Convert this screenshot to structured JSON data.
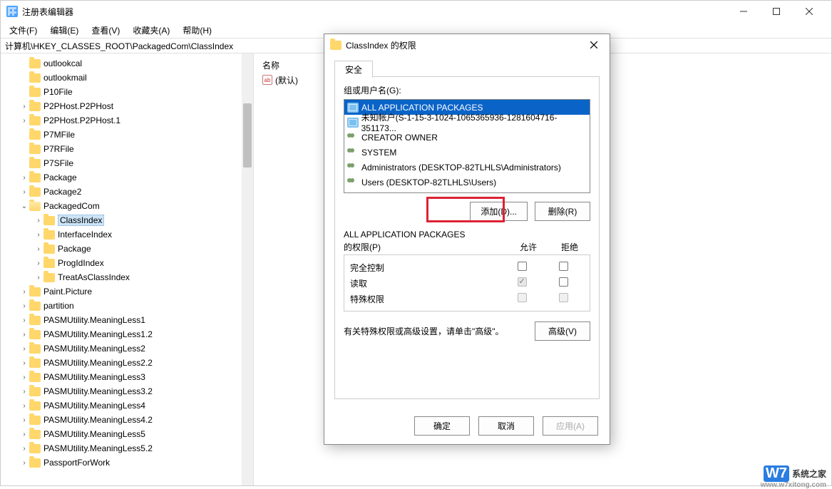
{
  "window": {
    "title": "注册表编辑器",
    "controls": {
      "min": "minimize",
      "max": "maximize",
      "close": "close"
    }
  },
  "menu": {
    "file": "文件(F)",
    "edit": "编辑(E)",
    "view": "查看(V)",
    "fav": "收藏夹(A)",
    "help": "帮助(H)"
  },
  "address": "计算机\\HKEY_CLASSES_ROOT\\PackagedCom\\ClassIndex",
  "list": {
    "header_name": "名称",
    "default_item": "(默认)"
  },
  "tree": [
    {
      "indent": 26,
      "chev": "",
      "label": "outlookcal"
    },
    {
      "indent": 26,
      "chev": "",
      "label": "outlookmail"
    },
    {
      "indent": 26,
      "chev": "",
      "label": "P10File"
    },
    {
      "indent": 26,
      "chev": ">",
      "label": "P2PHost.P2PHost"
    },
    {
      "indent": 26,
      "chev": ">",
      "label": "P2PHost.P2PHost.1"
    },
    {
      "indent": 26,
      "chev": "",
      "label": "P7MFile"
    },
    {
      "indent": 26,
      "chev": "",
      "label": "P7RFile"
    },
    {
      "indent": 26,
      "chev": "",
      "label": "P7SFile"
    },
    {
      "indent": 26,
      "chev": ">",
      "label": "Package"
    },
    {
      "indent": 26,
      "chev": ">",
      "label": "Package2"
    },
    {
      "indent": 26,
      "chev": "v",
      "label": "PackagedCom",
      "open": true
    },
    {
      "indent": 46,
      "chev": ">",
      "label": "ClassIndex",
      "selected": true
    },
    {
      "indent": 46,
      "chev": ">",
      "label": "InterfaceIndex"
    },
    {
      "indent": 46,
      "chev": ">",
      "label": "Package"
    },
    {
      "indent": 46,
      "chev": ">",
      "label": "ProgIdIndex"
    },
    {
      "indent": 46,
      "chev": ">",
      "label": "TreatAsClassIndex"
    },
    {
      "indent": 26,
      "chev": ">",
      "label": "Paint.Picture"
    },
    {
      "indent": 26,
      "chev": ">",
      "label": "partition"
    },
    {
      "indent": 26,
      "chev": ">",
      "label": "PASMUtility.MeaningLess1"
    },
    {
      "indent": 26,
      "chev": ">",
      "label": "PASMUtility.MeaningLess1.2"
    },
    {
      "indent": 26,
      "chev": ">",
      "label": "PASMUtility.MeaningLess2"
    },
    {
      "indent": 26,
      "chev": ">",
      "label": "PASMUtility.MeaningLess2.2"
    },
    {
      "indent": 26,
      "chev": ">",
      "label": "PASMUtility.MeaningLess3"
    },
    {
      "indent": 26,
      "chev": ">",
      "label": "PASMUtility.MeaningLess3.2"
    },
    {
      "indent": 26,
      "chev": ">",
      "label": "PASMUtility.MeaningLess4"
    },
    {
      "indent": 26,
      "chev": ">",
      "label": "PASMUtility.MeaningLess4.2"
    },
    {
      "indent": 26,
      "chev": ">",
      "label": "PASMUtility.MeaningLess5"
    },
    {
      "indent": 26,
      "chev": ">",
      "label": "PASMUtility.MeaningLess5.2"
    },
    {
      "indent": 26,
      "chev": ">",
      "label": "PassportForWork"
    }
  ],
  "dialog": {
    "title": "ClassIndex 的权限",
    "tab_security": "安全",
    "group_label": "组或用户名(G):",
    "users": [
      {
        "icon": "pkg",
        "label": "ALL APPLICATION PACKAGES",
        "selected": true
      },
      {
        "icon": "pkg",
        "label": "未知帐户(S-1-15-3-1024-1065365936-1281604716-351173...",
        "selected": false
      },
      {
        "icon": "usr",
        "label": "CREATOR OWNER",
        "selected": false
      },
      {
        "icon": "usr",
        "label": "SYSTEM",
        "selected": false
      },
      {
        "icon": "usr",
        "label": "Administrators (DESKTOP-82TLHLS\\Administrators)",
        "selected": false
      },
      {
        "icon": "usr",
        "label": "Users (DESKTOP-82TLHLS\\Users)",
        "selected": false
      }
    ],
    "btn_add": "添加(D)...",
    "btn_remove": "删除(R)",
    "perm_for": "ALL APPLICATION PACKAGES\n的权限(P)",
    "perm_for_line1": "ALL APPLICATION PACKAGES",
    "perm_for_line2": "的权限(P)",
    "col_allow": "允许",
    "col_deny": "拒绝",
    "perms": [
      {
        "name": "完全控制",
        "allow": "unchecked",
        "deny": "unchecked"
      },
      {
        "name": "读取",
        "allow": "checked-disabled",
        "deny": "unchecked"
      },
      {
        "name": "特殊权限",
        "allow": "disabled",
        "deny": "disabled"
      }
    ],
    "adv_text": "有关特殊权限或高级设置，请单击\"高级\"。",
    "btn_adv": "高级(V)",
    "btn_ok": "确定",
    "btn_cancel": "取消",
    "btn_apply": "应用(A)"
  },
  "watermark": {
    "brand": "W7",
    "text": "系统之家",
    "sub": "www.w7xitong.com"
  }
}
